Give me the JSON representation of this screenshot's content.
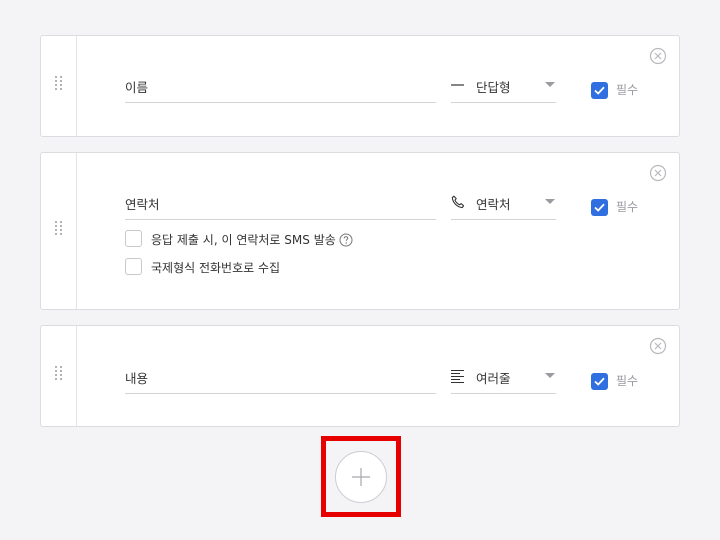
{
  "fields": [
    {
      "name_value": "이름",
      "type_label": "단답형",
      "type_icon": "short-answer-dash-icon",
      "required_label": "필수",
      "required_checked": true
    },
    {
      "name_value": "연락처",
      "type_label": "연락처",
      "type_icon": "phone-icon",
      "required_label": "필수",
      "required_checked": true,
      "options": [
        {
          "label": "응답 제출 시, 이 연락처로 SMS 발송",
          "checked": false,
          "has_help": true
        },
        {
          "label": "국제형식 전화번호로 수집",
          "checked": false
        }
      ]
    },
    {
      "name_value": "내용",
      "type_label": "여러줄",
      "type_icon": "multi-line-text-icon",
      "required_label": "필수",
      "required_checked": true
    }
  ],
  "colors": {
    "accent": "#2f6fe0",
    "highlight": "#e60000",
    "background": "#f4f4f6"
  }
}
